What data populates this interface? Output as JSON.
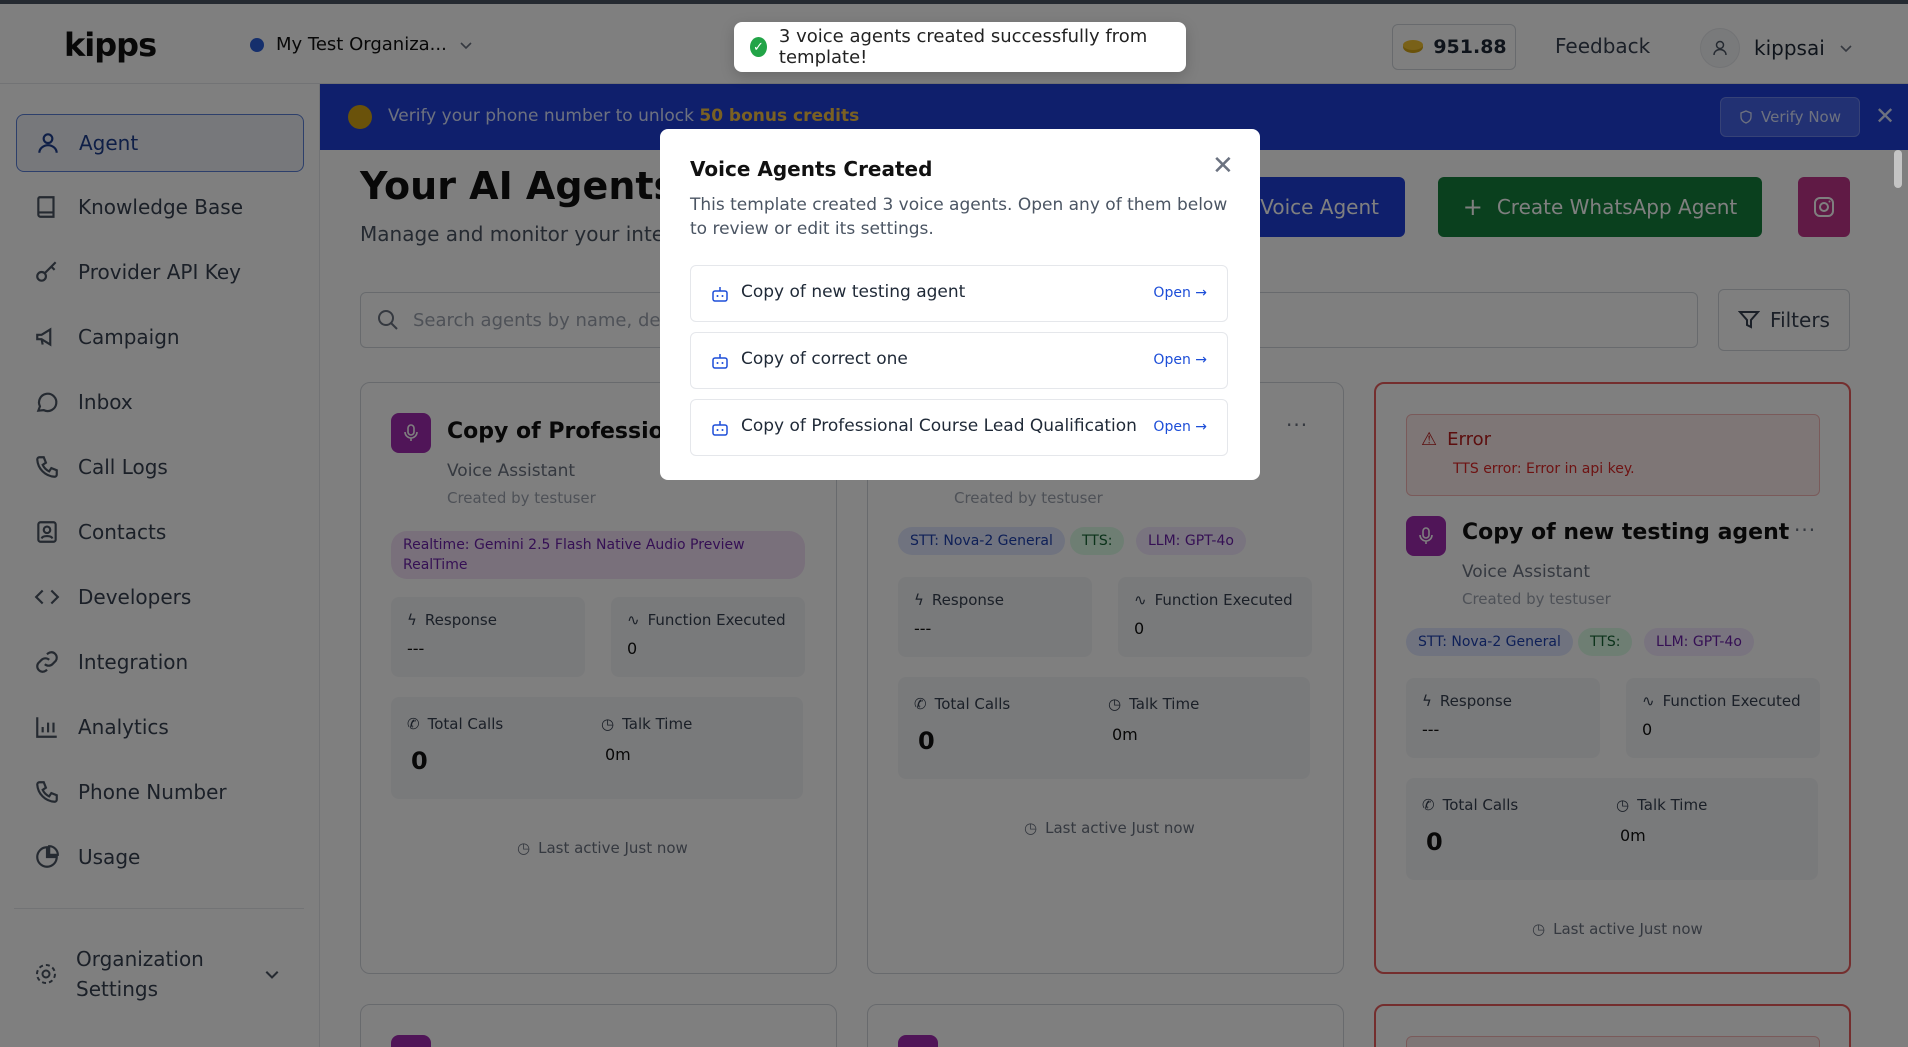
{
  "header": {
    "logo": "kipps",
    "org_name": "My Test Organiza...",
    "credits": "951.88",
    "feedback": "Feedback",
    "username": "kippsai"
  },
  "toast": {
    "message": "3 voice agents created successfully from template!"
  },
  "sidebar": {
    "items": [
      {
        "label": "Agent",
        "icon": "user-icon"
      },
      {
        "label": "Knowledge Base",
        "icon": "book-icon"
      },
      {
        "label": "Provider API Key",
        "icon": "key-icon"
      },
      {
        "label": "Campaign",
        "icon": "megaphone-icon"
      },
      {
        "label": "Inbox",
        "icon": "whatsapp-icon"
      },
      {
        "label": "Call Logs",
        "icon": "phone-icon"
      },
      {
        "label": "Contacts",
        "icon": "contact-icon"
      },
      {
        "label": "Developers",
        "icon": "code-icon"
      },
      {
        "label": "Integration",
        "icon": "link-icon"
      },
      {
        "label": "Analytics",
        "icon": "bar-chart-icon"
      },
      {
        "label": "Phone Number",
        "icon": "phone-icon"
      },
      {
        "label": "Usage",
        "icon": "pie-chart-icon"
      }
    ],
    "org_settings": "Organization Settings"
  },
  "banner": {
    "text": "Verify your phone number to unlock ",
    "highlight": "50 bonus credits",
    "verify_button": "Verify Now"
  },
  "main": {
    "title": "Your AI Agents",
    "subtitle": "Manage and monitor your intellig",
    "create_voice": "Voice Agent",
    "create_whatsapp": "Create WhatsApp Agent",
    "search_placeholder": "Search agents by name, descript",
    "filters": "Filters"
  },
  "cards": [
    {
      "name": "Copy of Professional",
      "type": "Voice Assistant",
      "created_by": "Created by testuser",
      "realtime_tag": "Realtime: Gemini 2.5 Flash Native Audio Preview RealTime",
      "response_label": "Response",
      "response_value": "---",
      "function_label": "Function Executed",
      "function_value": "0",
      "calls_label": "Total Calls",
      "calls_value": "0",
      "talk_label": "Talk Time",
      "talk_value": "0m",
      "last_active": "Last active Just now"
    },
    {
      "created_by": "Created by testuser",
      "stt": "STT: Nova-2 General",
      "tts": "TTS:",
      "llm": "LLM: GPT-4o",
      "response_label": "Response",
      "response_value": "---",
      "function_label": "Function Executed",
      "function_value": "0",
      "calls_label": "Total Calls",
      "calls_value": "0",
      "talk_label": "Talk Time",
      "talk_value": "0m",
      "last_active": "Last active Just now"
    },
    {
      "error_title": "Error",
      "error_message": "TTS error: Error in api key.",
      "name": "Copy of new testing agent",
      "type": "Voice Assistant",
      "created_by": "Created by testuser",
      "stt": "STT: Nova-2 General",
      "tts": "TTS:",
      "llm": "LLM: GPT-4o",
      "response_label": "Response",
      "response_value": "---",
      "function_label": "Function Executed",
      "function_value": "0",
      "calls_label": "Total Calls",
      "calls_value": "0",
      "talk_label": "Talk Time",
      "talk_value": "0m",
      "last_active": "Last active Just now"
    }
  ],
  "modal": {
    "title": "Voice Agents Created",
    "description": "This template created 3 voice agents. Open any of them below to review or edit its settings.",
    "agents": [
      {
        "name": "Copy of new testing agent",
        "open": "Open →"
      },
      {
        "name": "Copy of correct one",
        "open": "Open →"
      },
      {
        "name": "Copy of Professional Course Lead Qualification",
        "open": "Open →"
      }
    ]
  }
}
